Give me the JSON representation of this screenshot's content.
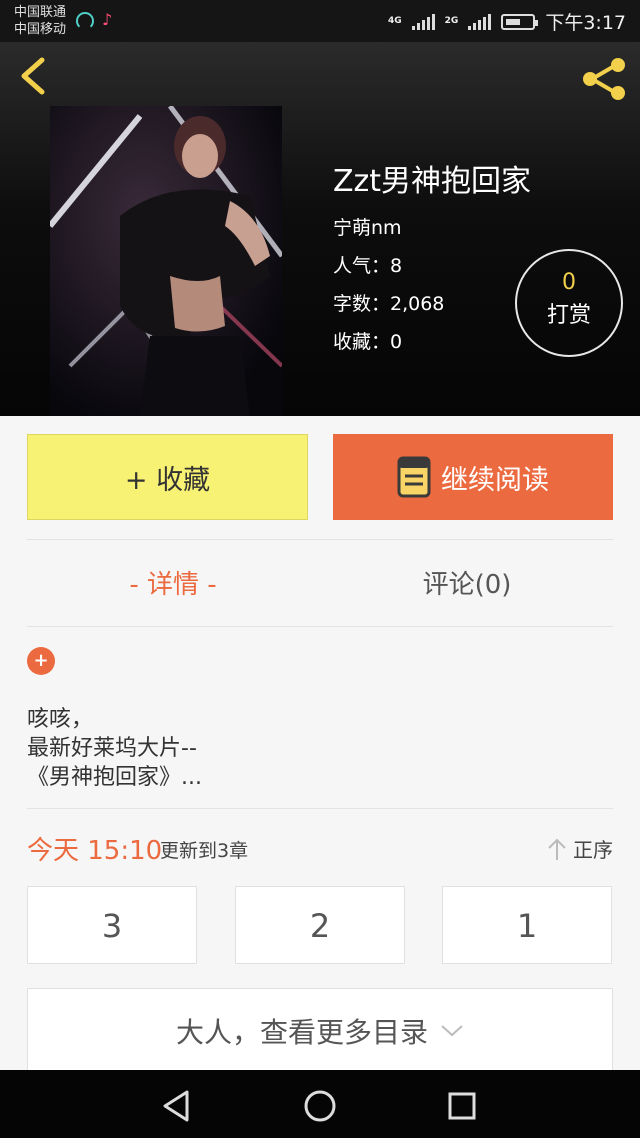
{
  "status": {
    "carrier1": "中国联通",
    "carrier2": "中国移动",
    "net1": "4G",
    "net2": "2G",
    "time": "下午3:17"
  },
  "book": {
    "title": "Zzt男神抱回家",
    "author": "宁萌nm",
    "popularity": "人气：8",
    "word_count": "字数：2,068",
    "favorites": "收藏：0",
    "reward_count": "0",
    "reward_label": "打赏"
  },
  "actions": {
    "favorite_label": "+ 收藏",
    "read_label": "继续阅读"
  },
  "tabs": {
    "detail": "- 详情 -",
    "comments": "评论(0)"
  },
  "description": {
    "expand": "+",
    "line1": "咳咳，",
    "line2": "最新好莱坞大片--",
    "line3": "《男神抱回家》..."
  },
  "updates": {
    "time": "今天 15:10",
    "text": "更新到3章",
    "sort_label": "正序"
  },
  "chapters": [
    "3",
    "2",
    "1"
  ],
  "more_label": "大人，查看更多目录",
  "colors": {
    "accent": "#ec6a3f",
    "favorite_bg": "#f8f274",
    "reward_number": "#f2d04b"
  }
}
